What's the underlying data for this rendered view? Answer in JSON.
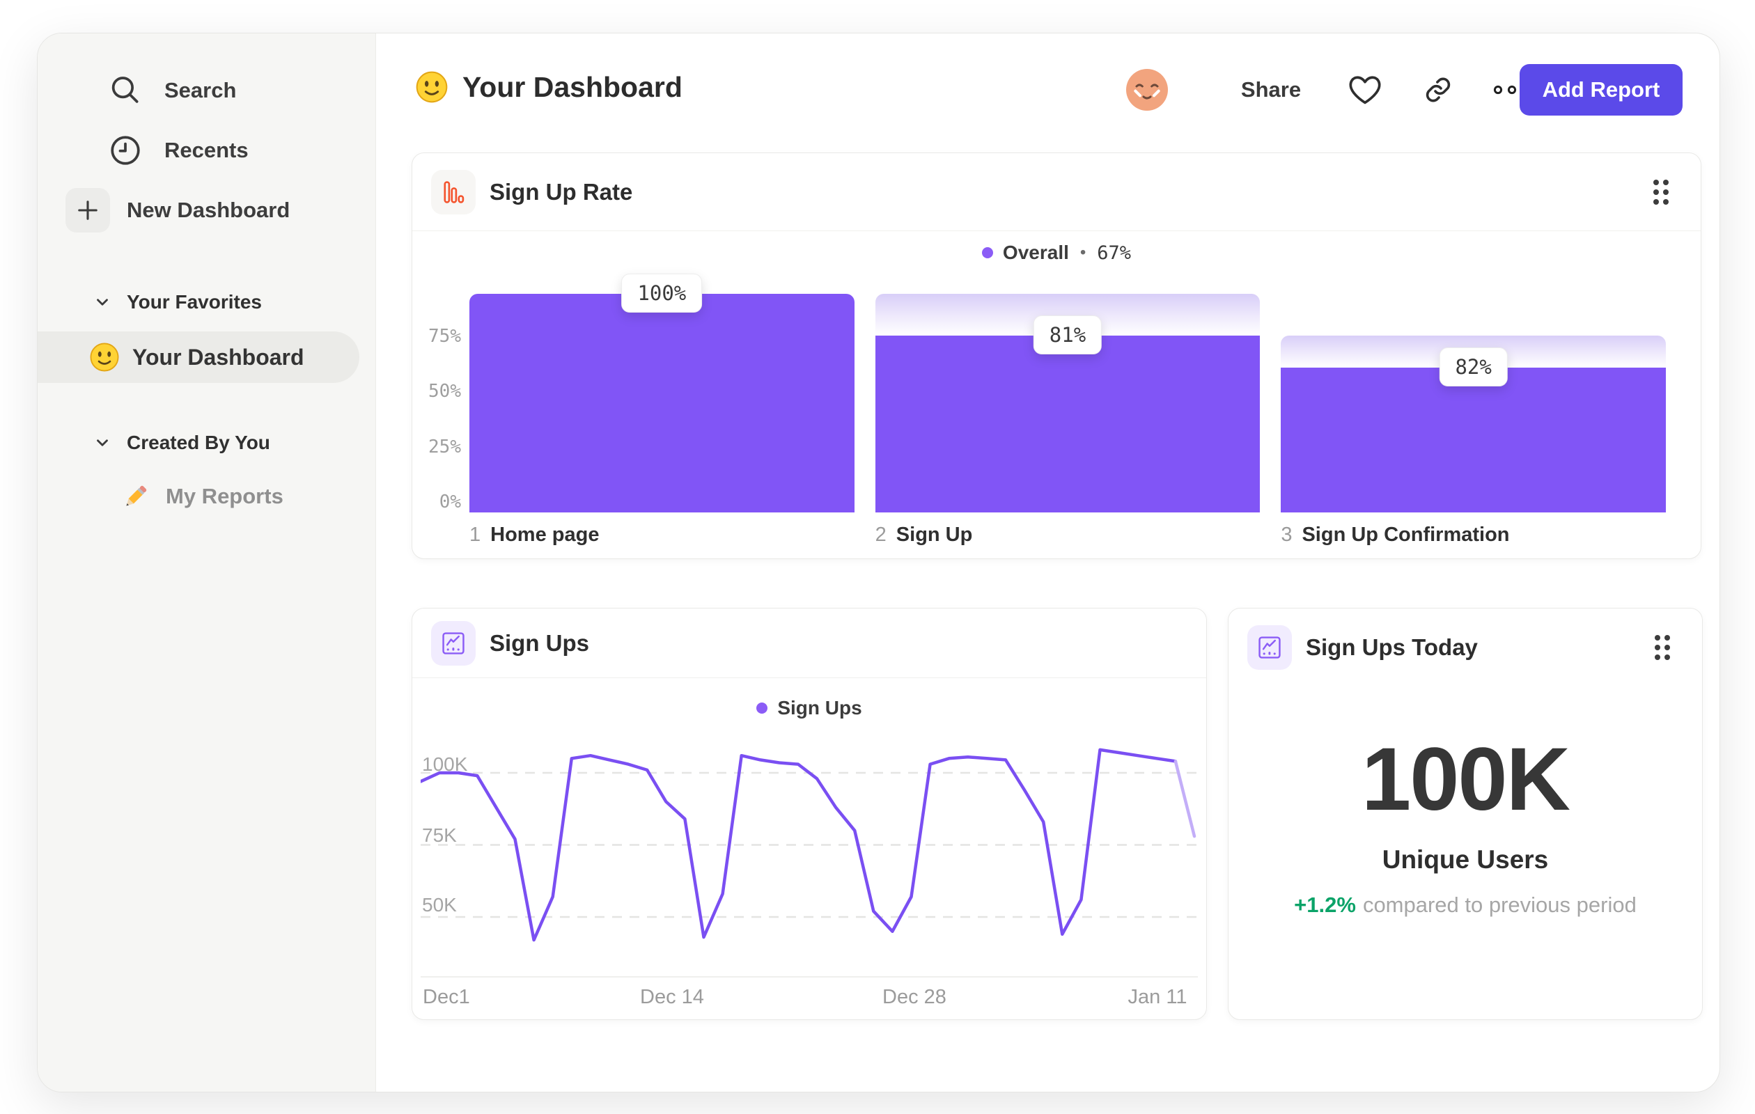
{
  "sidebar": {
    "search": "Search",
    "recents": "Recents",
    "new_dashboard": "New Dashboard",
    "favorites_section": "Your Favorites",
    "favorite_item": "Your Dashboard",
    "created_section": "Created By You",
    "created_item": "My Reports"
  },
  "header": {
    "title": "Your Dashboard",
    "share": "Share",
    "add_report": "Add Report"
  },
  "colors": {
    "bar_purple": "#8155f6",
    "line_purple": "#7a4ff2",
    "line_tail_light": "#c3aef8",
    "legend_dot": "#8b5cf6",
    "button_purple": "#5b4ae9",
    "funnel_icon_orange": "#f4542e",
    "chart_icon_purple": "#8b5cf6",
    "positive_green": "#0ba368"
  },
  "chart_data": [
    {
      "type": "bar",
      "variant": "funnel",
      "title": "Sign Up Rate",
      "legend": {
        "series": "Overall",
        "separator": "•",
        "value": "67%"
      },
      "ylim": [
        0,
        100
      ],
      "yticks": [
        "75%",
        "50%",
        "25%",
        "0%"
      ],
      "steps": [
        {
          "index": "1",
          "label": "Home page",
          "badge": "100%",
          "step_conversion_pct": 100,
          "overall_pct": 100
        },
        {
          "index": "2",
          "label": "Sign Up",
          "badge": "81%",
          "step_conversion_pct": 81,
          "overall_pct": 81
        },
        {
          "index": "3",
          "label": "Sign Up Confirmation",
          "badge": "82%",
          "step_conversion_pct": 82,
          "overall_pct": 66.4
        }
      ]
    },
    {
      "type": "line",
      "title": "Sign Ups",
      "legend": "Sign Ups",
      "yticks": [
        "100K",
        "75K",
        "50K"
      ],
      "ytick_values_k": [
        100,
        75,
        50
      ],
      "xticks": [
        "Dec1",
        "Dec 14",
        "Dec 28",
        "Jan 11"
      ],
      "xtick_day_index": [
        0,
        13,
        27,
        41
      ],
      "values_k": [
        97,
        100,
        100,
        99,
        88,
        77,
        42,
        57,
        105,
        106,
        104.5,
        103,
        101,
        90,
        84,
        43,
        58,
        106,
        104.5,
        103.5,
        103,
        98,
        88,
        80,
        52,
        45,
        57,
        103,
        105,
        105.5,
        105,
        104.5,
        94,
        83,
        44,
        56,
        108,
        107,
        106,
        105,
        104,
        78
      ],
      "incomplete_tail_points": 2
    },
    {
      "type": "single_value",
      "title": "Sign Ups Today",
      "value": "100K",
      "label": "Unique Users",
      "change": "+1.2%",
      "change_caption": "compared to previous period"
    }
  ]
}
